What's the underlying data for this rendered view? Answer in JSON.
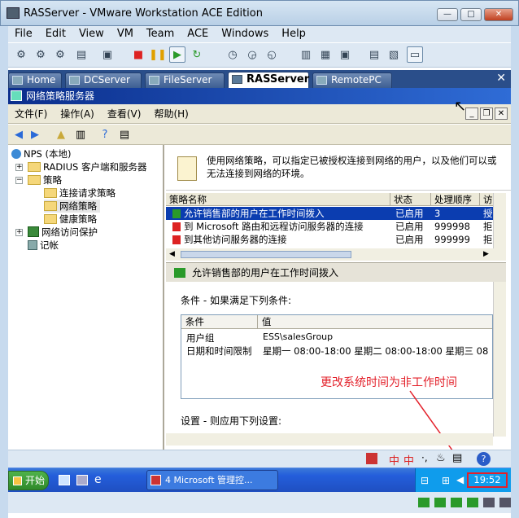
{
  "window": {
    "title": "RASServer - VMware Workstation ACE Edition",
    "min": "—",
    "max": "□",
    "close": "✕"
  },
  "vm_menu": [
    "File",
    "Edit",
    "View",
    "VM",
    "Team",
    "ACE",
    "Windows",
    "Help"
  ],
  "tabs": [
    {
      "label": "Home",
      "active": false
    },
    {
      "label": "DCServer",
      "active": false
    },
    {
      "label": "FileServer",
      "active": false
    },
    {
      "label": "RASServer",
      "active": true
    },
    {
      "label": "RemotePC",
      "active": false
    }
  ],
  "tab_close": "✕",
  "mmc": {
    "title": "网络策略服务器",
    "menu": [
      "文件(F)",
      "操作(A)",
      "查看(V)",
      "帮助(H)"
    ],
    "ctrl": [
      "_",
      "❐",
      "✕"
    ]
  },
  "tree": {
    "root": "NPS (本地)",
    "radius": "RADIUS 客户端和服务器",
    "policies": "策略",
    "conn_req": "连接请求策略",
    "network_policies": "网络策略",
    "health": "健康策略",
    "nap": "网络访问保护",
    "accounting": "记帐"
  },
  "info_text": "使用网络策略，可以指定已被授权连接到网络的用户，以及他们可以或无法连接到网络的环境。",
  "list": {
    "headers": [
      "策略名称",
      "状态",
      "处理顺序",
      "访"
    ],
    "rows": [
      {
        "name": "允许销售部的用户在工作时间拨入",
        "status": "已启用",
        "order": "3",
        "extra": "授",
        "selected": true,
        "icon": "green-check-icon"
      },
      {
        "name": "到 Microsoft 路由和远程访问服务器的连接",
        "status": "已启用",
        "order": "999998",
        "extra": "拒",
        "selected": false,
        "icon": "red-x-icon"
      },
      {
        "name": "到其他访问服务器的连接",
        "status": "已启用",
        "order": "999999",
        "extra": "拒",
        "selected": false,
        "icon": "red-x-icon"
      }
    ]
  },
  "detail": {
    "header": "允许销售部的用户在工作时间拨入",
    "conditions_label": "条件 - 如果满足下列条件:",
    "cond_headers": [
      "条件",
      "值"
    ],
    "cond_rows": [
      {
        "cond": "用户组",
        "value": "ESS\\salesGroup"
      },
      {
        "cond": "日期和时间限制",
        "value": "星期一 08:00-18:00 星期二 08:00-18:00 星期三 08"
      }
    ],
    "settings_label": "设置 - 则应用下列设置:"
  },
  "annotation": "更改系统时间为非工作时间",
  "taskbar": {
    "start": "开始",
    "task": "4 Microsoft 管理控...",
    "clock": "19:52"
  },
  "status_ime": "中"
}
